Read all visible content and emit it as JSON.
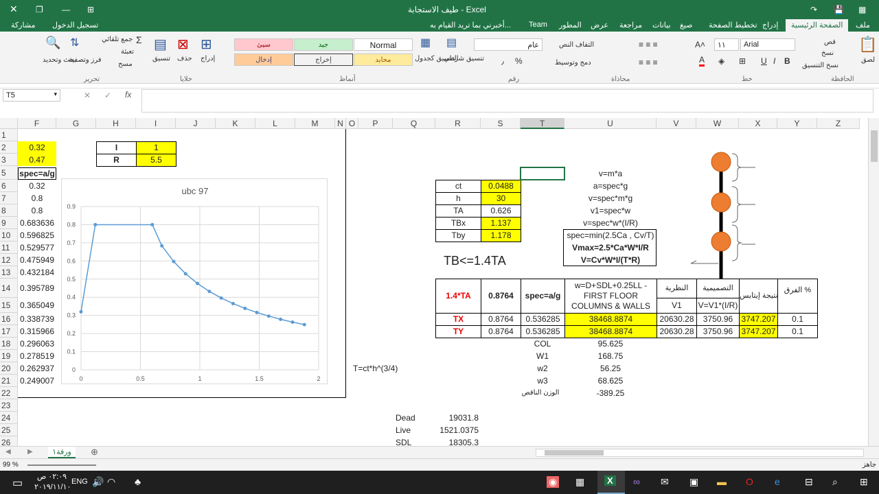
{
  "titlebar": {
    "title": "طيف الاستجابة - Excel",
    "close": "✕",
    "restore": "❐",
    "minimize": "—",
    "ribbon_opts": "⊞"
  },
  "menubar": {
    "tabs": [
      "ملف",
      "الصفحة الرئيسية",
      "إدراج",
      "تخطيط الصفحة",
      "صيغ",
      "بيانات",
      "مراجعة",
      "عرض",
      "المطور",
      "Team"
    ],
    "tellme": "أخبرني بما تريد القيام به...",
    "signin": "تسجيل الدخول",
    "share": "مشاركة"
  },
  "ribbon": {
    "clipboard": {
      "paste": "لصق",
      "cut": "قص",
      "copy": "نسخ",
      "format_painter": "نسخ التنسيق",
      "group": "الحافظة"
    },
    "font": {
      "name": "Arial",
      "size": "١١",
      "group": "خط"
    },
    "alignment": {
      "wrap": "التفاف النص",
      "merge": "دمج وتوسيط",
      "group": "محاذاة"
    },
    "number": {
      "format": "عام",
      "percent": "%",
      "comma": "٫",
      "group": "رقم"
    },
    "styles": {
      "conditional": "تنسيق شرطي",
      "table": "التنسيق كجدول",
      "normal": "Normal",
      "bad": "سيئ",
      "good": "جيد",
      "neutral": "محايد",
      "calculation": "إخراج",
      "input": "إدخال",
      "group": "أنماط"
    },
    "cells": {
      "insert": "إدراج",
      "delete": "حذف",
      "format": "تنسيق",
      "group": "خلايا"
    },
    "editing": {
      "autosum": "جمع تلقائي",
      "fill": "تعبئة",
      "clear": "مسح",
      "sort": "فرز وتصفية",
      "find": "بحث وتحديد",
      "group": "تحرير"
    }
  },
  "formula": {
    "namebox": "T5",
    "fx": "fx",
    "value": ""
  },
  "columns": [
    "F",
    "G",
    "H",
    "I",
    "J",
    "K",
    "L",
    "M",
    "N",
    "O",
    "P",
    "Q",
    "R",
    "S",
    "T",
    "U",
    "V",
    "W",
    "X",
    "Y",
    "Z"
  ],
  "rows": [
    "1",
    "2",
    "3",
    "5",
    "6",
    "7",
    "8",
    "9",
    "10",
    "11",
    "12",
    "13",
    "14",
    "15",
    "16",
    "17",
    "18",
    "19",
    "20",
    "21",
    "22",
    "23",
    "24",
    "25",
    "26"
  ],
  "cells": {
    "F2": "0.32",
    "F3": "0.47",
    "F5": "spec=a/g",
    "F6": "0.32",
    "F7": "0.8",
    "F8": "0.8",
    "F9": "0.683636",
    "F10": "0.596825",
    "F11": "0.529577",
    "F12": "0.475949",
    "F13": "0.432184",
    "F14": "0.395789",
    "F15": "0.365049",
    "F16": "0.338739",
    "F17": "0.315966",
    "F18": "0.296063",
    "F19": "0.278519",
    "F20": "0.262937",
    "F21": "0.249007",
    "H2": "I",
    "I2": "1",
    "H3": "R",
    "I3": "5.5",
    "R6": "ct",
    "S6": "0.0488",
    "R7": "h",
    "S7": "30",
    "R8": "TA",
    "S8": "0.626",
    "R9": "TBx",
    "S9": "1.137",
    "R10": "Tby",
    "S10": "1.178",
    "U5": "v=m*a",
    "U6": "a=spec*g",
    "U7": "v=spec*m*g",
    "U8": "v1=spec*w",
    "U9": "v=spec*w*(I/R)",
    "U10": "spec=min(2.5Ca , Cv/T)",
    "U11": "Vmax=2.5*Ca*W*I/R",
    "U12": "V=Cv*W*I/(T*R)",
    "R12": "TB<=1.4TA",
    "R14": "1.4*TA",
    "S14": "0.8764",
    "T14": "spec=a/g",
    "U14": "w=D+SDL+0.25LL -FIRST FLOOR COLUMNS & WALLS",
    "V14": "النظرية",
    "W14": "التصميمية",
    "X14": "نتيجة إيتابس",
    "Y14": "الفرق %",
    "V15": "V1",
    "W15": "V=V1*(I/R)",
    "R16": "TX",
    "S16": "0.8764",
    "T16": "0.536285",
    "U16": "38468.8874",
    "V16": "20630.28",
    "W16": "3750.96",
    "X16": "3747.207",
    "Y16": "0.1",
    "R17": "TY",
    "S17": "0.8764",
    "T17": "0.536285",
    "U17": "38468.8874",
    "V17": "20630.28",
    "W17": "3750.96",
    "X17": "3747.207",
    "Y17": "0.1",
    "T18": "COL",
    "U18": "95.625",
    "T19": "W1",
    "U19": "168.75",
    "T20": "w2",
    "U20": "56.25",
    "T21": "w3",
    "U21": "68.625",
    "T22": "الوزن الناقص",
    "U22": "-389.25",
    "P20": "T=ct*h^(3/4)",
    "Q24": "Dead",
    "R24": "19031.8",
    "Q25": "Live",
    "R25": "1521.0375",
    "Q26": "SDL",
    "R26": "18305.3"
  },
  "chart_data": {
    "type": "line",
    "title": "ubc 97",
    "x": [
      0,
      0.12,
      0.6,
      0.68,
      0.78,
      0.88,
      0.98,
      1.08,
      1.18,
      1.28,
      1.38,
      1.48,
      1.58,
      1.68,
      1.78,
      1.88
    ],
    "y": [
      0.32,
      0.8,
      0.8,
      0.683636,
      0.596825,
      0.529577,
      0.475949,
      0.432184,
      0.395789,
      0.365049,
      0.338739,
      0.315966,
      0.296063,
      0.278519,
      0.262937,
      0.249007
    ],
    "xlim": [
      0,
      2
    ],
    "ylim": [
      0,
      0.9
    ],
    "xticks": [
      "0",
      "0.5",
      "1",
      "1.5",
      "2"
    ],
    "yticks": [
      "0",
      "0.1",
      "0.2",
      "0.3",
      "0.4",
      "0.5",
      "0.6",
      "0.7",
      "0.8",
      "0.9"
    ],
    "grid": true,
    "color": "#5b9bd5"
  },
  "sheet": {
    "tab": "ورقة١",
    "add": "⊕"
  },
  "status": {
    "ready": "جاهز",
    "zoom": "99 %"
  },
  "taskbar": {
    "time": "٠٢:٠٩ ص",
    "date": "٢٠١٩/١١/١٠",
    "lang": "ENG"
  }
}
